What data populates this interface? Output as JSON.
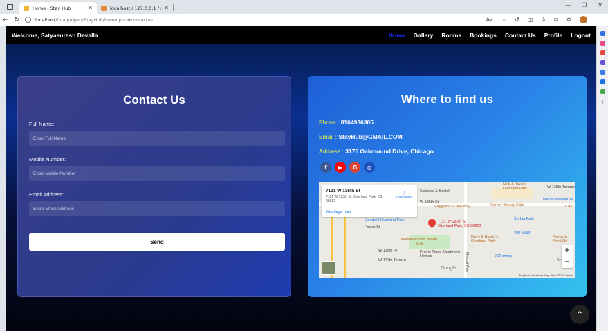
{
  "browser": {
    "tabs": [
      {
        "title": "Home - Stay Hub",
        "active": true
      },
      {
        "title": "localhost / 127.0.0.1 / stayhub / ...",
        "active": false
      }
    ],
    "url_host": "localhost",
    "url_path": "/finalproject/StayHub/home.php#contactus"
  },
  "nav": {
    "welcome": "Welcome, Satyasuresh Devalla",
    "links": [
      "Home",
      "Gallery",
      "Rooms",
      "Bookings",
      "Contact Us",
      "Profile",
      "Logout"
    ],
    "active": "Home"
  },
  "contact_form": {
    "title": "Contact Us",
    "full_name_label": "Full Name:",
    "full_name_placeholder": "Enter Full Name",
    "mobile_label": "Mobile Number:",
    "mobile_placeholder": "Enter Mobile Number",
    "email_label": "Email Address:",
    "email_placeholder": "Enter Email Address",
    "send_label": "Send"
  },
  "find_us": {
    "title": "Where to find us",
    "phone_key": "Phone :",
    "phone_value": "8164936305",
    "email_key": "Email :",
    "email_value": "StayHub@GMAIL.COM",
    "address_key": "Address :",
    "address_value": "3176 Oakmound Drive, Chicago",
    "socials": [
      "facebook-icon",
      "youtube-icon",
      "google-icon",
      "instagram-icon"
    ],
    "colors": {
      "accent_yellow": "#e7f23f",
      "facebook": "#3b5998",
      "youtube": "#ff0000",
      "google": "#db4437",
      "instagram": "#1f4fbf"
    }
  },
  "map": {
    "card_title": "7121 W 135th St",
    "card_address": "7121 W 135th St, Overland Park, KS 66223",
    "card_link": "View larger map",
    "directions": "Directions",
    "labels": {
      "scissors": "Scissors & Scotch",
      "nick": "Nick & Jake's Overland Park",
      "maggianos": "Maggiano's Little Italy",
      "corner": "Corner Bakery Cafe",
      "mens": "Men's Wearhouse",
      "goodwill": "Goodwill Overland Park",
      "pin": "7121 W 135th St, Overland Park, KS 66223",
      "corbin": "Corbin Park",
      "vonmaur": "Von Maur",
      "hawaiian": "Hawaiian Bros Island Grill",
      "dave": "Dave & Buster's Overland Park",
      "firebird": "Firebirds Fired Gri",
      "prairie": "Prairie Trace Apartment Homes",
      "jcpenney": "JCPenney",
      "w135": "W 135th St",
      "w135b": "W 135th Terrace",
      "w137": "W 137th Terrace",
      "w136": "W 136th Pl",
      "foster": "Foster St",
      "metcalf": "Metcalf Ave",
      "cav": "CAV",
      "sc": "Sc"
    },
    "google": "Google",
    "footer": "Keyboard shortcuts   Map data ©2023   Terms"
  }
}
